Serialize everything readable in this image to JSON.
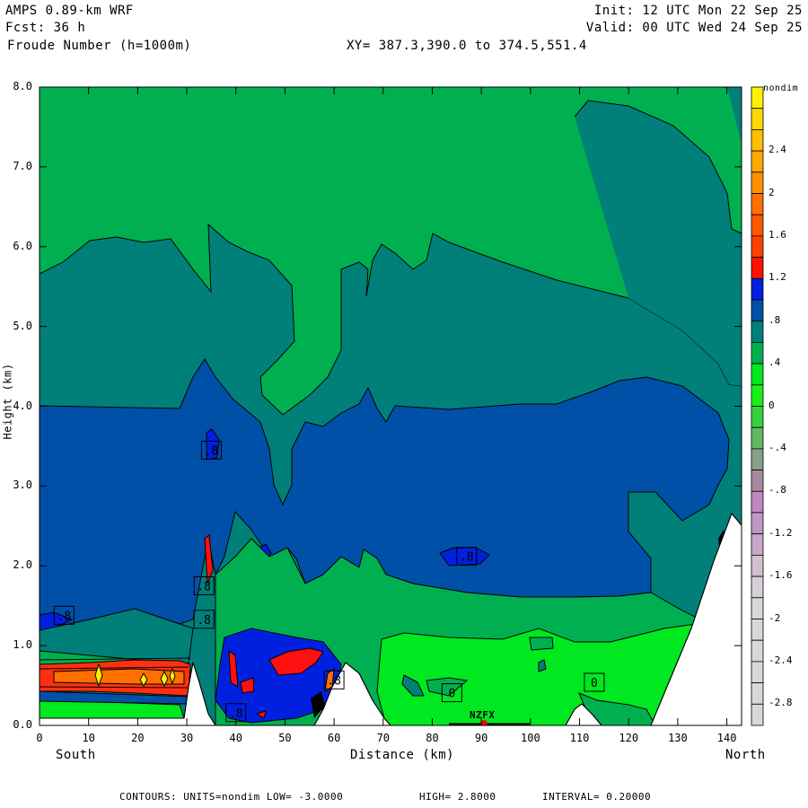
{
  "header": {
    "model": "AMPS 0.89-km WRF",
    "forecast": "Fcst:   36 h",
    "field": "Froude Number (h=1000m)",
    "init": "Init: 12 UTC Mon 22 Sep 25",
    "valid": "Valid: 00 UTC Wed 24 Sep 25",
    "xy": "XY= 387.3,390.0 to 374.5,551.4"
  },
  "chart_data": {
    "type": "heatmap",
    "subtype": "filled contour vertical cross-section",
    "title": "Froude Number (h=1000m)",
    "xlabel": "Distance (km)",
    "ylabel": "Height (km)",
    "x_left_label": "South",
    "x_right_label": "North",
    "xlim": [
      0,
      143
    ],
    "ylim": [
      0,
      8
    ],
    "xticks": [
      "0",
      "10",
      "20",
      "30",
      "40",
      "50",
      "60",
      "70",
      "80",
      "90",
      "100",
      "110",
      "120",
      "130",
      "140"
    ],
    "yticks": [
      "0.0",
      "1.0",
      "2.0",
      "3.0",
      "4.0",
      "5.0",
      "6.0",
      "7.0",
      "8.0"
    ],
    "colorbar": {
      "units": "nondim",
      "min": -3.0,
      "max": 3.0,
      "interval": 0.2,
      "labels": [
        "2.4",
        "2",
        "1.6",
        "1.2",
        ".8",
        ".4",
        "0",
        "-.4",
        "-.8",
        "-1.2",
        "-1.6",
        "-2",
        "-2.4",
        "-2.8"
      ],
      "label_values": [
        2.4,
        2.0,
        1.6,
        1.2,
        0.8,
        0.4,
        0.0,
        -0.4,
        -0.8,
        -1.2,
        -1.6,
        -2.0,
        -2.4,
        -2.8
      ],
      "colors_top_to_bottom": [
        "#fff200",
        "#ffd800",
        "#ffc000",
        "#ffa800",
        "#ff9000",
        "#ff7000",
        "#ff5800",
        "#ff4000",
        "#ff1000",
        "#0020e0",
        "#0050a8",
        "#008078",
        "#00b050",
        "#00e820",
        "#18f018",
        "#38d040",
        "#60b860",
        "#88a088",
        "#a888a0",
        "#c088c0",
        "#c098c8",
        "#c8a8c8",
        "#d0c0d0",
        "#d8d0d8",
        "#d8d8d8",
        "#d8d8d8",
        "#d8d8d8",
        "#d8d8d8",
        "#d8d8d8",
        "#d8d8d8"
      ]
    },
    "regions": [
      {
        "range": "0.2 to 0.4",
        "color": "#00b050",
        "location": "upper atmosphere 5-8 km"
      },
      {
        "range": "0.4 to 0.6",
        "color": "#008078",
        "location": "band 4-6 km and near-surface"
      },
      {
        "range": "0.6 to 0.8",
        "color": "#0050a8",
        "location": "1.5-4 km layer"
      },
      {
        "range": "0.8 to 1.0",
        "color": "#0020e0",
        "location": "lee of terrain 35-60 km"
      },
      {
        "range": "> 1.0",
        "color": "#ff1010",
        "location": "0.4-0.8 km south of 30 km, 45-55 km"
      },
      {
        "range": "0 to 0.2",
        "color": "#00e820",
        "location": "low levels 70-125 km"
      }
    ],
    "contour_labels": [
      {
        "text": ".8",
        "x_km": 35,
        "z_km": 3.45
      },
      {
        "text": ".8",
        "x_km": 33.5,
        "z_km": 1.75
      },
      {
        "text": ".8",
        "x_km": 33.5,
        "z_km": 1.33
      },
      {
        "text": ".8",
        "x_km": 5,
        "z_km": 1.38
      },
      {
        "text": ".8",
        "x_km": 87,
        "z_km": 2.12
      },
      {
        "text": ".8",
        "x_km": 40,
        "z_km": 0.16
      },
      {
        "text": ".8",
        "x_km": 60,
        "z_km": 0.57
      },
      {
        "text": "0",
        "x_km": 84,
        "z_km": 0.41
      },
      {
        "text": "0",
        "x_km": 113,
        "z_km": 0.54
      }
    ],
    "station": {
      "name": "NZFX",
      "x_km": 90.5
    },
    "terrain_peaks_km": [
      {
        "x": 31,
        "z": 0.8
      },
      {
        "x": 64,
        "z": 0.8
      },
      {
        "x": 111,
        "z": 0.25
      },
      {
        "x": 141,
        "z": 2.7
      }
    ]
  },
  "footer": {
    "contours": "CONTOURS:  UNITS=nondim  LOW= -3.0000",
    "high": "HIGH=  2.8000",
    "interval": "INTERVAL=  0.20000"
  }
}
